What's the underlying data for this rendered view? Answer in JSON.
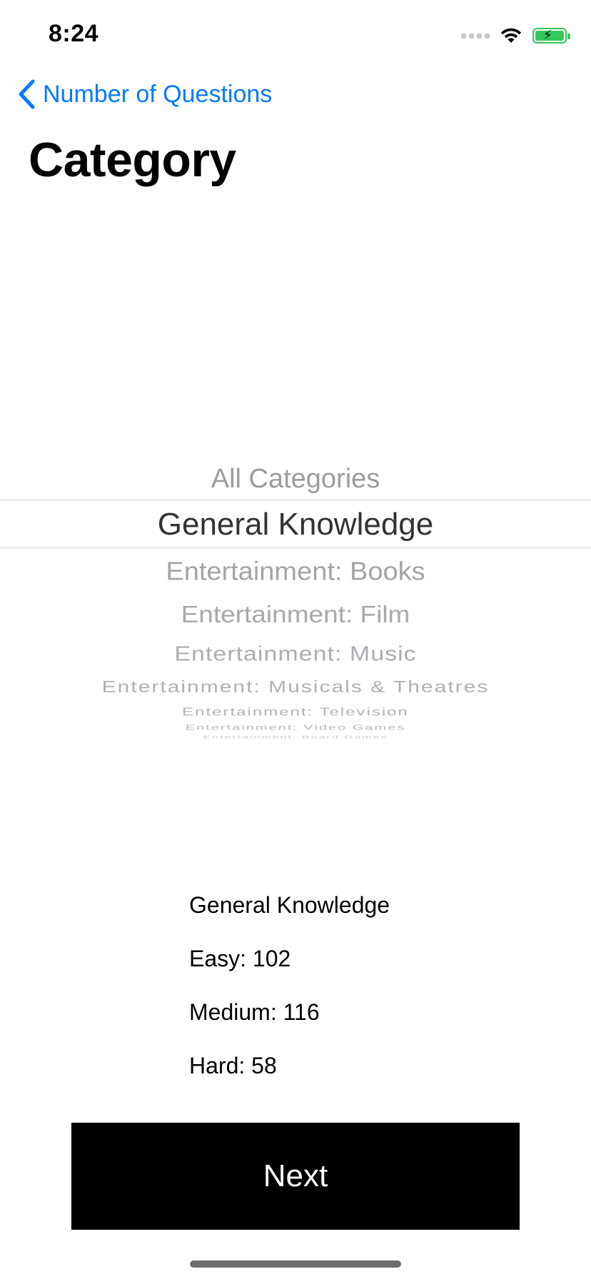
{
  "status_bar": {
    "time": "8:24",
    "icons": [
      "signal-icon",
      "wifi-icon",
      "battery-charging-icon"
    ],
    "battery_color": "#34c759"
  },
  "nav": {
    "back_label": "Number of Questions",
    "back_icon": "chevron-left-icon",
    "accent_color": "#007aff"
  },
  "page": {
    "title": "Category"
  },
  "picker": {
    "selected": "General Knowledge",
    "items": [
      "All Categories",
      "General Knowledge",
      "Entertainment: Books",
      "Entertainment: Film",
      "Entertainment: Music",
      "Entertainment: Musicals & Theatres",
      "Entertainment: Television",
      "Entertainment: Video Games",
      "Entertainment: Board Games"
    ]
  },
  "info": {
    "category": "General Knowledge",
    "easy": "Easy: 102",
    "medium": "Medium: 116",
    "hard": "Hard: 58"
  },
  "actions": {
    "next_label": "Next"
  }
}
